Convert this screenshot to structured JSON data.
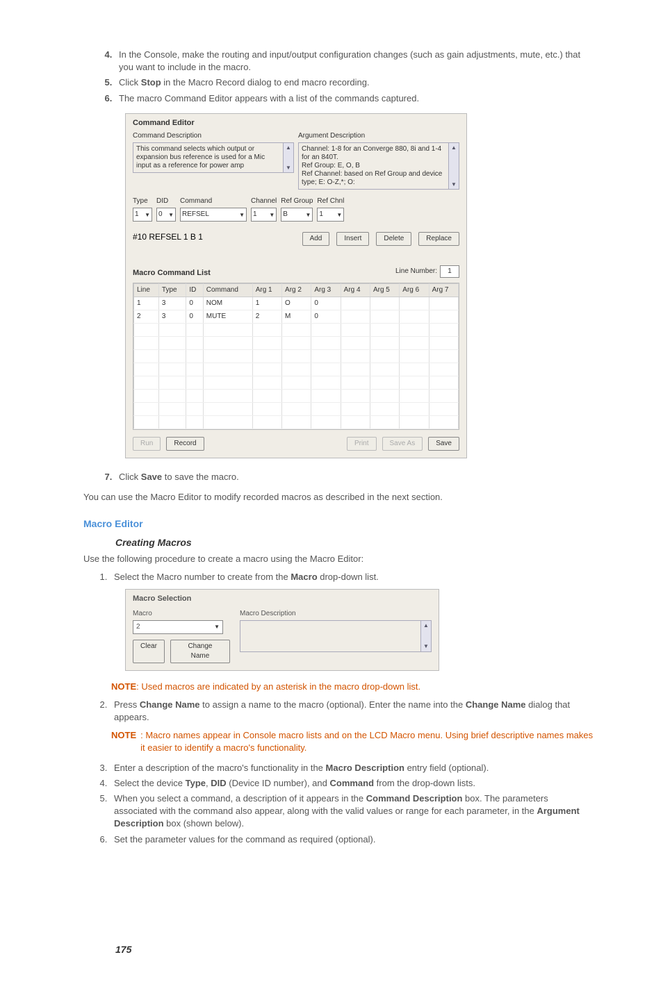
{
  "steps_top": {
    "s4": {
      "text_a": "In the Console, make the routing and input/output configuration changes (such as gain adjustments, mute, etc.) that you want to include in the macro."
    },
    "s5": {
      "pre": "Click ",
      "bold": "Stop",
      "post": " in the Macro Record dialog to end macro recording."
    },
    "s6": {
      "text": "The macro Command Editor appears with a list of the commands captured."
    }
  },
  "command_editor": {
    "title": "Command Editor",
    "cmd_desc_label": "Command Description",
    "arg_desc_label": "Argument Description",
    "cmd_desc_text": "This command selects which output or expansion bus reference is used for a Mic input as a reference for power amp",
    "arg_desc_text": "Channel: 1-8 for an Converge 880, 8i and 1-4 for an 840T.\nRef Group: E, O, B\nRef Channel: based on Ref Group and device type; E: O-Z,*; O:",
    "type_label": "Type",
    "did_label": "DID",
    "command_label": "Command",
    "channel_label": "Channel",
    "refgroup_label": "Ref Group",
    "refchnl_label": "Ref Chnl",
    "type_val": "1",
    "did_val": "0",
    "command_val": "REFSEL",
    "channel_val": "1",
    "refgroup_val": "B",
    "refchnl_val": "1",
    "command_line": "#10 REFSEL 1 B 1",
    "btn_add": "Add",
    "btn_insert": "Insert",
    "btn_delete": "Delete",
    "btn_replace": "Replace",
    "macro_list_title": "Macro Command List",
    "line_number_label": "Line Number:",
    "line_number_val": "1",
    "headers": [
      "Line",
      "Type",
      "ID",
      "Command",
      "Arg 1",
      "Arg 2",
      "Arg 3",
      "Arg 4",
      "Arg 5",
      "Arg 6",
      "Arg 7"
    ],
    "rows": [
      [
        "1",
        "3",
        "0",
        "NOM",
        "1",
        "O",
        "0",
        "",
        "",
        "",
        ""
      ],
      [
        "2",
        "3",
        "0",
        "MUTE",
        "2",
        "M",
        "0",
        "",
        "",
        "",
        ""
      ]
    ],
    "btn_run": "Run",
    "btn_record": "Record",
    "btn_print": "Print",
    "btn_saveas": "Save As",
    "btn_save": "Save"
  },
  "steps_after": {
    "s7": {
      "pre": "Click ",
      "bold": "Save",
      "post": " to save the macro."
    }
  },
  "para_after": "You can use the Macro Editor to modify recorded macros as described in the next section.",
  "macro_editor_heading": "Macro Editor",
  "creating_heading": "Creating Macros",
  "creating_intro": "Use the following procedure to create a macro using the Macro Editor:",
  "creating_steps": {
    "s1": {
      "pre": "Select the Macro number to create from the ",
      "bold": "Macro",
      "post": " drop-down list."
    },
    "s2": {
      "pre": "Press ",
      "b1": "Change Name",
      "mid": " to assign a name to the macro (optional). Enter the name into the ",
      "b2": "Change Name",
      "post": " dialog that appears."
    },
    "s3": {
      "pre": "Enter a description of the macro's functionality in the ",
      "bold": "Macro Description",
      "post": " entry field (optional)."
    },
    "s4": {
      "pre": "Select the device ",
      "b1": "Type",
      "mid1": ", ",
      "b2": "DID",
      "mid2": " (Device ID number), and ",
      "b3": "Command",
      "post": " from the drop-down lists."
    },
    "s5": {
      "pre": "When you select a command, a description of it appears in the ",
      "b1": "Command Description",
      "mid": " box. The parameters associated with the command also appear, along with the valid values or range for each parameter, in the ",
      "b2": "Argument Description",
      "post": " box (shown below)."
    },
    "s6": {
      "text": "Set the parameter values for the command as required (optional)."
    }
  },
  "note1": {
    "label": "NOTE",
    "text": ": Used macros are indicated by an asterisk in the macro drop-down list."
  },
  "note2": {
    "label": "NOTE",
    "text": ": Macro names appear in Console macro lists and on the LCD Macro menu. Using brief descriptive names makes it easier to identify a macro's functionality."
  },
  "macro_selection": {
    "title": "Macro Selection",
    "macro_label": "Macro",
    "macro_val": "2",
    "desc_label": "Macro Description",
    "btn_clear": "Clear",
    "btn_change": "Change Name"
  },
  "page_number": "175"
}
